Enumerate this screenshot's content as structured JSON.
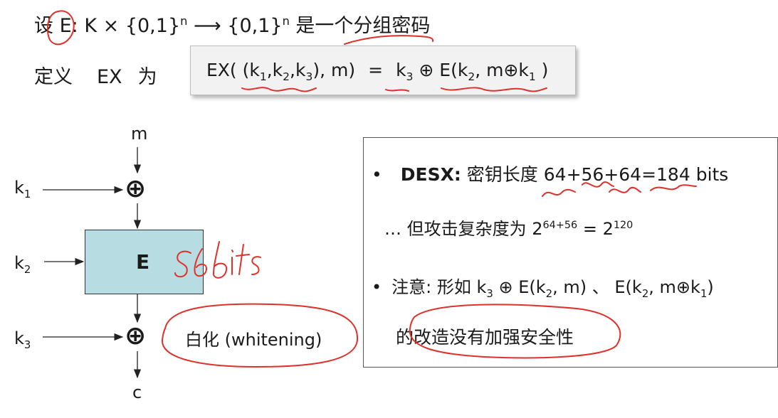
{
  "definition": {
    "line1_prefix": "设 E",
    "line1_sig": ": K × {0,1}",
    "n_sup": "n",
    "arrow": " ⟶ {0,1}",
    "line1_suffix": " 是一个分组密码",
    "line2_prefix": "定义",
    "ex_name": "EX",
    "line2_wei": "为"
  },
  "formula": {
    "lhs_a": "EX( (k",
    "s1": "1",
    "comma_k": ",k",
    "s2": "2",
    "s3": "3",
    "lhs_b": "), m)",
    "eq": "=",
    "k": "k",
    "xor_e": " ⊕ E(k",
    "m_xor": ", m⊕k",
    "close": " )"
  },
  "diagram": {
    "input_label": "m",
    "key1_label": "k",
    "key2_label": "k",
    "key3_label": "k",
    "output_label": "c",
    "cipher_label": "E",
    "handwritten_note": "56bits",
    "whitening_label": "白化 (whitening)"
  },
  "notes": {
    "desx_label": "DESX:",
    "desx_text": " 密钥长度 64+56+64=184 bits",
    "attack_text": "… 但攻击复杂度为  2",
    "exp1": "64+56",
    "equals_two": " = 2",
    "exp2": "120",
    "caution_prefix": "注意:  形如 k",
    "caution_mid": " ⊕ E(k",
    "caution_m": ", m) 、 E(k",
    "caution_mk": ", m⊕k",
    "caution_close": ")",
    "conclusion": "的改造没有加强安全性",
    "bullet": "•"
  },
  "colors": {
    "cipher_box": "#b7dde3",
    "handwriting": "#e0302a"
  }
}
